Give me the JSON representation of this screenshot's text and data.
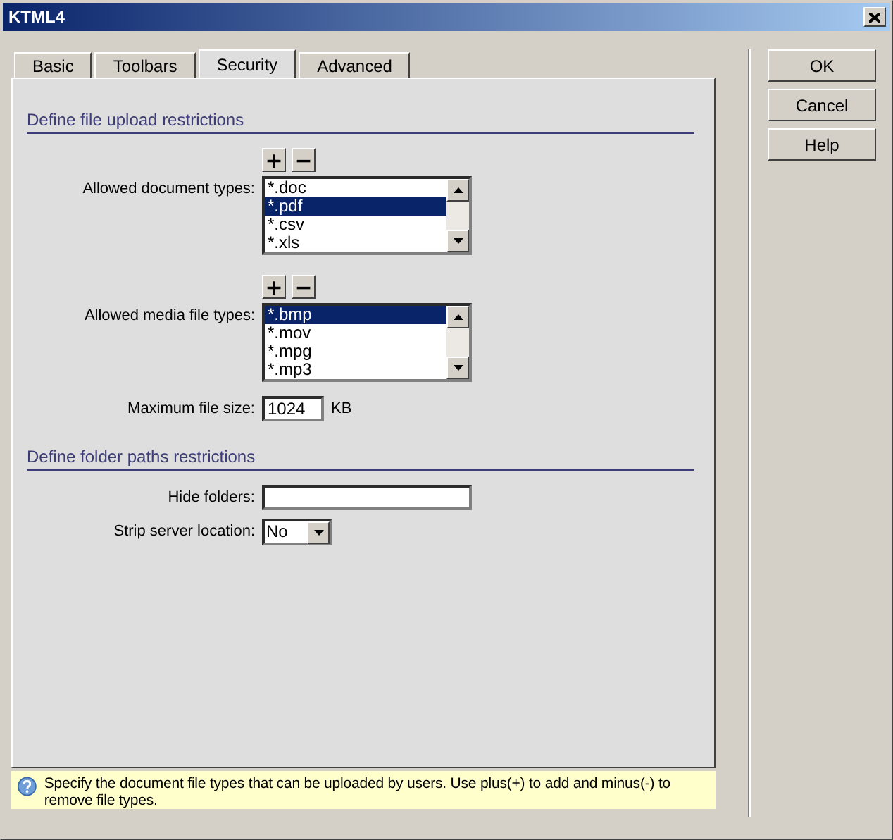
{
  "window": {
    "title": "KTML4"
  },
  "tabs": [
    {
      "label": "Basic",
      "selected": false
    },
    {
      "label": "Toolbars",
      "selected": false
    },
    {
      "label": "Security",
      "selected": true
    },
    {
      "label": "Advanced",
      "selected": false
    }
  ],
  "sections": [
    {
      "title": "Define file upload restrictions",
      "fields": [
        {
          "kind": "list",
          "label": "Allowed document types:",
          "add": "+",
          "remove": "−",
          "items": [
            {
              "text": "*.doc",
              "selected": false
            },
            {
              "text": "*.pdf",
              "selected": true
            },
            {
              "text": "*.csv",
              "selected": false
            },
            {
              "text": "*.xls",
              "selected": false
            }
          ]
        },
        {
          "kind": "list",
          "label": "Allowed media file types:",
          "add": "+",
          "remove": "−",
          "items": [
            {
              "text": "*.bmp",
              "selected": true
            },
            {
              "text": "*.mov",
              "selected": false
            },
            {
              "text": "*.mpg",
              "selected": false
            },
            {
              "text": "*.mp3",
              "selected": false
            }
          ]
        },
        {
          "kind": "text",
          "label": "Maximum file size:",
          "value": "1024",
          "unit": "KB"
        }
      ]
    },
    {
      "title": "Define folder paths restrictions",
      "fields": [
        {
          "kind": "text",
          "label": "Hide folders:"
        },
        {
          "kind": "select",
          "label": "Strip server location:",
          "value": "No"
        }
      ]
    }
  ],
  "help": "Specify the document file types that can be uploaded by users. Use plus(+) to add and minus(-) to remove file types.",
  "buttons": [
    "OK",
    "Cancel",
    "Help"
  ]
}
